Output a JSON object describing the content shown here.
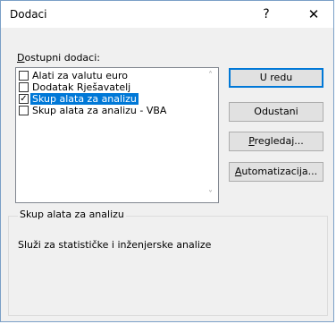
{
  "window": {
    "title": "Dodaci",
    "help_label": "?",
    "close_label": "✕"
  },
  "list": {
    "label_accel": "D",
    "label_rest": "ostupni dodaci:",
    "items": [
      {
        "label": "Alati za valutu euro",
        "checked": false,
        "selected": false
      },
      {
        "label": "Dodatak Rješavatelj",
        "checked": false,
        "selected": false
      },
      {
        "label": "Skup alata za analizu",
        "checked": true,
        "selected": true
      },
      {
        "label": "Skup alata za analizu - VBA",
        "checked": false,
        "selected": false
      }
    ],
    "scroll_up_icon": "˄",
    "scroll_down_icon": "˅"
  },
  "buttons": {
    "ok": "U redu",
    "cancel": "Odustani",
    "browse_accel": "P",
    "browse_rest": "regledaj...",
    "automation_accel": "A",
    "automation_rest": "utomatizacija..."
  },
  "description": {
    "title": "Skup alata za analizu",
    "text": "Služi za statističke i inženjerske analize"
  },
  "colors": {
    "selection": "#0078d7",
    "dialog_bg": "#f0f0f0"
  }
}
